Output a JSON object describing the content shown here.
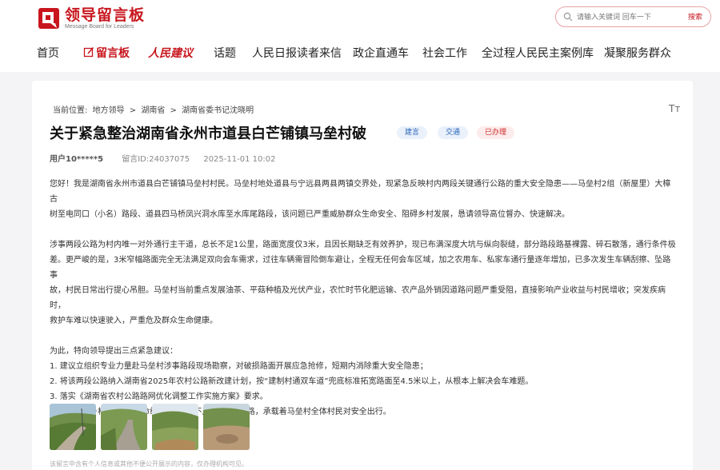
{
  "header": {
    "logo_cn": "领导留言板",
    "logo_en": "Message Board for Leaders",
    "search_placeholder": "请输入关键词 回车一下",
    "search_button": "搜索"
  },
  "nav": {
    "items": [
      "首页",
      "留言板",
      "人民建议",
      "话题",
      "人民日报读者来信",
      "政企直通车",
      "社会工作",
      "全过程人民民主案例库",
      "凝聚服务群众"
    ]
  },
  "article": {
    "breadcrumb": {
      "label": "当前位置:",
      "crumbs": [
        "地方领导",
        ">",
        "湖南省",
        ">",
        "湖南省委书记沈晓明"
      ]
    },
    "font_toggle": "Tт",
    "title": "关于紧急整治湖南省永州市道县白芒铺镇马垒村破",
    "tags": [
      "建言",
      "交通",
      "已办理"
    ],
    "user": "用户10*****5",
    "message_id": "留言ID:24037075",
    "date": "2025-11-01 10:02",
    "paragraphs": [
      [
        "您好！我是湖南省永州市道县白芒铺镇马垒村村民。马垒村地处道县与宁远县两县两镇交界处，现紧急反映村内两段关键通行公路的重大安全隐患——马垒村2组（新屋里）大樟古",
        "树至电同口（小名）路段、道县四马桥凤兴洞水库至水库尾路段，该问题已严重威胁群众生命安全、阻碍乡村发展，恳请领导高位督办、快速解决。"
      ],
      [
        "涉事两段公路为村内唯一对外通行主干道，总长不足1公里，路面宽度仅3米，且因长期缺乏有效养护，现已布满深度大坑与纵向裂缝，部分路段路基裸露、碎石散落，通行条件极",
        "差。更严峻的是，3米窄幅路面完全无法满足双向会车需求，过往车辆需冒险倒车避让，全程无任何会车区域，加之农用车、私家车通行量逐年增加，已多次发生车辆刮擦、坠路事",
        "故，村民日常出行提心吊胆。马垒村当前重点发展油茶、平菇种植及光伏产业，农忙时节化肥运输、农产品外销因道路问题严重受阻，直接影响产业收益与村民增收；突发疾病时，",
        "救护车难以快速驶入，严重危及群众生命健康。"
      ],
      [
        "为此，特向领导提出三点紧急建议：",
        "1. 建议立组织专业力量赴马垒村涉事路段现场勘察，对破损路面开展应急抢修，短期内消除重大安全隐患；",
        "2. 将该两段公路纳入湖南省2025年农村公路新改建计划，按“建制村通双车道”兜底标准拓宽路面至4.5米以上，从根本上解决会车难题。",
        "3. 落实《湖南省农村公路路网优化调整工作实施方案》要求。",
        "农村公路是乡村振兴的“生命线”，这两段不足1公里的道路，承载着马垒村全体村民对安全出行。"
      ]
    ],
    "disclaimer": "该留言中含有个人信息或其他不便公开展示的内容，仅办理机构可见。"
  },
  "colors": {
    "brand_red": "#c8161e",
    "tag_blue": "#2a66b8",
    "tag_red": "#d02b2b"
  }
}
